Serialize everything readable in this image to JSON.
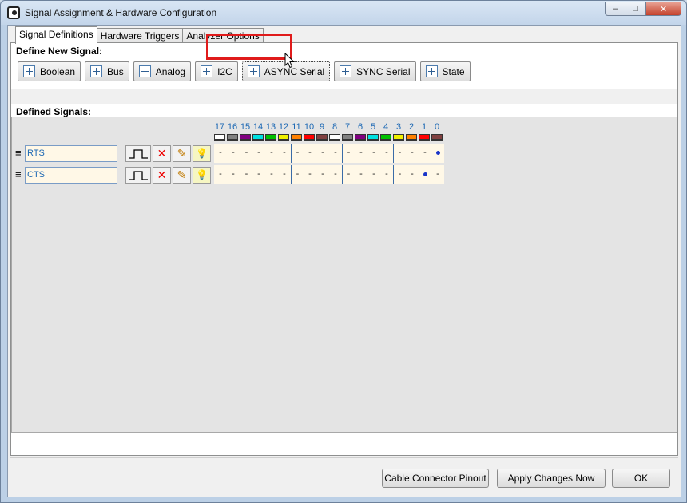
{
  "window": {
    "title": "Signal Assignment & Hardware Configuration",
    "min_glyph": "–",
    "max_glyph": "□",
    "close_glyph": "✕"
  },
  "tabs": [
    {
      "label": "Signal Definitions",
      "active": true
    },
    {
      "label": "Hardware Triggers",
      "active": false
    },
    {
      "label": "Analyzer Options",
      "active": false
    }
  ],
  "define": {
    "title": "Define New Signal:",
    "buttons": [
      "Boolean",
      "Bus",
      "Analog",
      "I2C",
      "ASYNC Serial",
      "SYNC Serial",
      "State"
    ],
    "highlighted": "ASYNC Serial"
  },
  "defined": {
    "title": "Defined Signals:",
    "channels": [
      {
        "n": "17",
        "color": "#ffffff"
      },
      {
        "n": "16",
        "color": "#808080"
      },
      {
        "n": "15",
        "color": "#800080"
      },
      {
        "n": "14",
        "color": "#00e0e0"
      },
      {
        "n": "13",
        "color": "#00c000"
      },
      {
        "n": "12",
        "color": "#f0f000"
      },
      {
        "n": "11",
        "color": "#ff8000"
      },
      {
        "n": "10",
        "color": "#ff0000"
      },
      {
        "n": "9",
        "color": "#804040"
      },
      {
        "n": "8",
        "color": "#ffffff"
      },
      {
        "n": "7",
        "color": "#808080"
      },
      {
        "n": "6",
        "color": "#800080"
      },
      {
        "n": "5",
        "color": "#00e0e0"
      },
      {
        "n": "4",
        "color": "#00c000"
      },
      {
        "n": "3",
        "color": "#f0f000"
      },
      {
        "n": "2",
        "color": "#ff8000"
      },
      {
        "n": "1",
        "color": "#ff0000"
      },
      {
        "n": "0",
        "color": "#804040"
      }
    ],
    "signals": [
      {
        "name": "RTS",
        "assigned_channel": "0"
      },
      {
        "name": "CTS",
        "assigned_channel": "1"
      }
    ],
    "empty_marker": "-"
  },
  "footer": {
    "pinout_label": "Cable Connector Pinout",
    "apply_label": "Apply Changes Now",
    "ok_label": "OK"
  }
}
